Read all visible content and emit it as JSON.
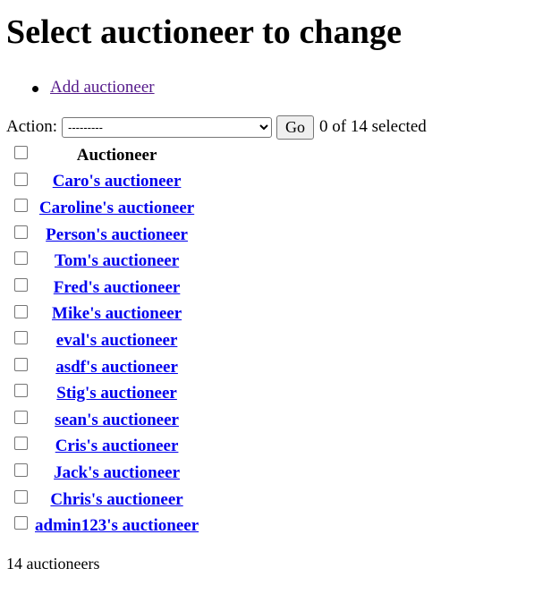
{
  "page": {
    "title": "Select auctioneer to change"
  },
  "object_tools": {
    "add_label": "Add auctioneer"
  },
  "actions": {
    "label": "Action:",
    "selected_option": "---------",
    "go_label": "Go",
    "counter": "0 of 14 selected"
  },
  "table": {
    "column_header": "Auctioneer",
    "rows": [
      "Caro's auctioneer",
      "Caroline's auctioneer",
      "Person's auctioneer",
      "Tom's auctioneer",
      "Fred's auctioneer",
      "Mike's auctioneer",
      "eval's auctioneer",
      "asdf's auctioneer",
      "Stig's auctioneer",
      "sean's auctioneer",
      "Cris's auctioneer",
      "Jack's auctioneer",
      "Chris's auctioneer",
      "admin123's auctioneer"
    ]
  },
  "footer": {
    "count": "14 auctioneers"
  },
  "colors": {
    "link": "#0000ee",
    "visited_link": "#551a8b",
    "text": "#000000",
    "background": "#ffffff"
  }
}
